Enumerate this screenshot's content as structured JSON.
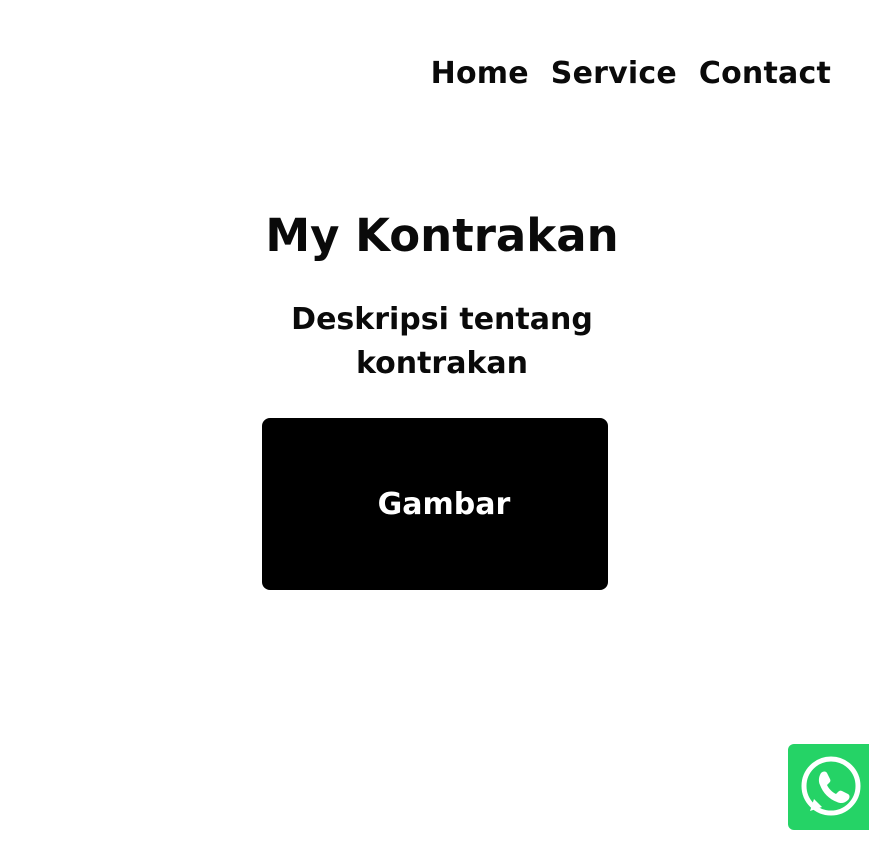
{
  "nav": {
    "items": [
      {
        "label": "Home"
      },
      {
        "label": "Service"
      },
      {
        "label": "Contact"
      }
    ]
  },
  "hero": {
    "title": "My Kontrakan",
    "description": "Deskripsi tentang kontrakan"
  },
  "image_placeholder": {
    "label": "Gambar"
  },
  "whatsapp": {
    "icon": "whatsapp-icon",
    "color": "#25d366"
  }
}
